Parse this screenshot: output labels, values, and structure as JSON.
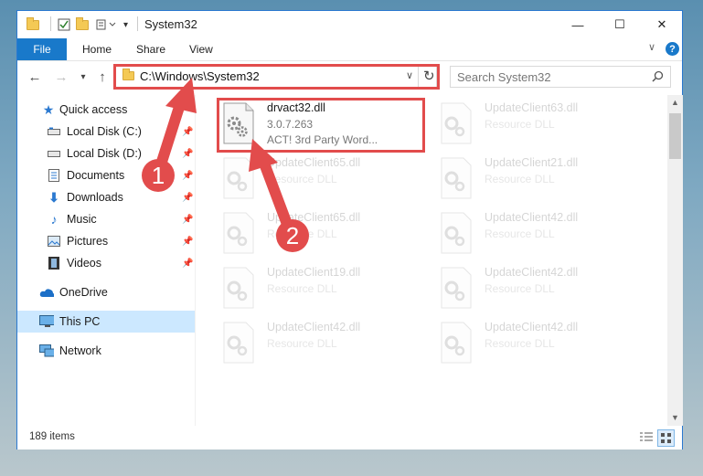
{
  "window": {
    "title": "System32",
    "controls": {
      "minimize": "—",
      "maximize": "☐",
      "close": "✕"
    }
  },
  "ribbon": {
    "tabs": [
      "File",
      "Home",
      "Share",
      "View"
    ]
  },
  "navigation": {
    "back": "←",
    "forward": "→",
    "recent": "▾",
    "up": "↑"
  },
  "address": {
    "path": "C:\\Windows\\System32",
    "refresh": "↻",
    "dropdown": "∨"
  },
  "search": {
    "placeholder": "Search System32"
  },
  "sidebar": {
    "items": [
      {
        "label": "Quick access",
        "icon": "star-icon"
      },
      {
        "label": "Local Disk (C:)",
        "icon": "drive-icon"
      },
      {
        "label": "Local Disk (D:)",
        "icon": "drive-icon"
      },
      {
        "label": "Documents",
        "icon": "documents-icon"
      },
      {
        "label": "Downloads",
        "icon": "download-icon"
      },
      {
        "label": "Music",
        "icon": "music-icon"
      },
      {
        "label": "Pictures",
        "icon": "pictures-icon"
      },
      {
        "label": "Videos",
        "icon": "videos-icon"
      },
      {
        "label": "OneDrive",
        "icon": "cloud-icon"
      },
      {
        "label": "This PC",
        "icon": "computer-icon"
      },
      {
        "label": "Network",
        "icon": "network-icon"
      }
    ]
  },
  "files": {
    "highlighted": {
      "name": "drvact32.dll",
      "version": "3.0.7.263",
      "description": "ACT! 3rd Party Word..."
    },
    "faded": [
      {
        "name": "UpdateClient63.dll",
        "type": "Resource DLL"
      },
      {
        "name": "UpdateClient65.dll",
        "type": "Resource DLL"
      },
      {
        "name": "UpdateClient21.dll",
        "type": "Resource DLL"
      },
      {
        "name": "UpdateClient65.dll",
        "type": "Resource DLL"
      },
      {
        "name": "UpdateClient42.dll",
        "type": "Resource DLL"
      },
      {
        "name": "UpdateClient19.dll",
        "type": "Resource DLL"
      },
      {
        "name": "UpdateClient42.dll",
        "type": "Resource DLL"
      },
      {
        "name": "UpdateClient42.dll",
        "type": "Resource DLL"
      },
      {
        "name": "UpdateClient42.dll",
        "type": "Resource DLL"
      }
    ]
  },
  "status": {
    "count": "189 items"
  },
  "annotations": {
    "callout_1": "1",
    "callout_2": "2",
    "color": "#e24c4c"
  }
}
